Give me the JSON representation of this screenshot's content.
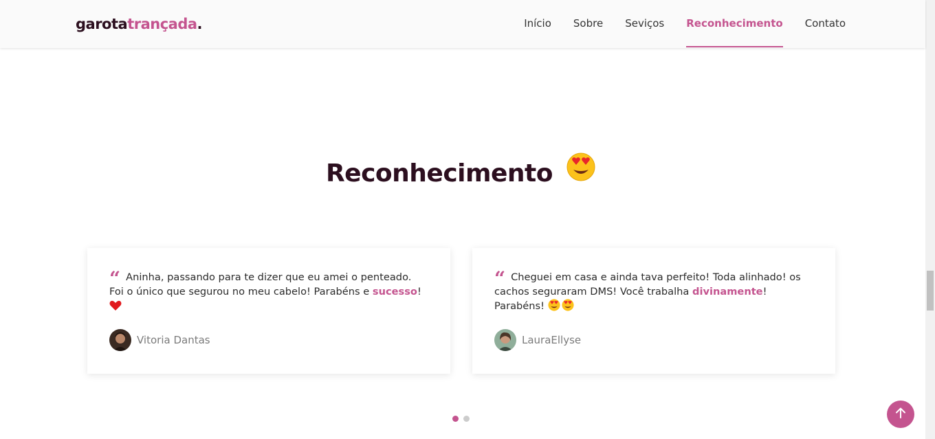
{
  "header": {
    "logo": {
      "part1": "garota",
      "part2": "trançada",
      "part3": "."
    },
    "nav": [
      {
        "label": "Início",
        "active": false
      },
      {
        "label": "Sobre",
        "active": false
      },
      {
        "label": "Seviços",
        "active": false
      },
      {
        "label": "Reconhecimento",
        "active": true
      },
      {
        "label": "Contato",
        "active": false
      }
    ]
  },
  "section": {
    "title": "Reconhecimento",
    "title_icon": "heart-eyes-emoji"
  },
  "testimonials": [
    {
      "text_before": "Aninha, passando para te dizer que eu amei o penteado. Foi o único que segurou no meu cabelo! Parabéns e ",
      "highlight": "sucesso",
      "text_after": "!",
      "trailing_icon": "red-heart-emoji",
      "author": "Vitoria Dantas"
    },
    {
      "text_before": "Cheguei em casa e ainda tava perfeito! Toda alinhado! os cachos seguraram DMS! Você trabalha ",
      "highlight": "divinamente",
      "text_after": "! Parabéns! ",
      "trailing_icon": "heart-eyes-emoji-x2",
      "author": "LauraEllyse"
    }
  ],
  "pagination": {
    "total": 2,
    "active": 1
  },
  "colors": {
    "accent": "#c4548f",
    "dark": "#2c0f1f"
  }
}
